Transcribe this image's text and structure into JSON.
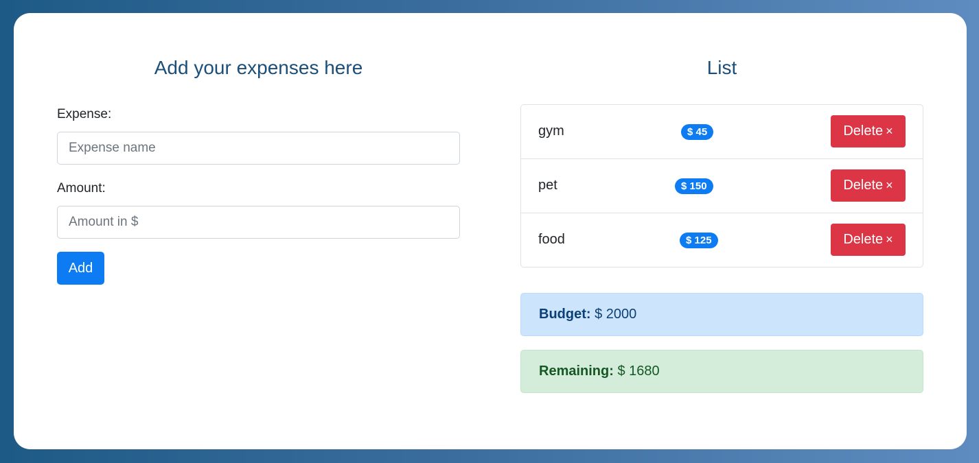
{
  "form": {
    "title": "Add your expenses here",
    "expense_label": "Expense:",
    "expense_placeholder": "Expense name",
    "amount_label": "Amount:",
    "amount_placeholder": "Amount in $",
    "add_label": "Add"
  },
  "list": {
    "title": "List",
    "delete_label": "Delete",
    "delete_icon": "×",
    "items": [
      {
        "name": "gym",
        "badge": "$ 45"
      },
      {
        "name": "pet",
        "badge": "$ 150"
      },
      {
        "name": "food",
        "badge": "$ 125"
      }
    ]
  },
  "summary": {
    "budget_label": "Budget:",
    "budget_value": "$ 2000",
    "remaining_label": "Remaining:",
    "remaining_value": "$ 1680"
  },
  "colors": {
    "primary": "#0d7cf2",
    "danger": "#dc3545",
    "info_bg": "#cce5fc",
    "success_bg": "#d4edda"
  }
}
